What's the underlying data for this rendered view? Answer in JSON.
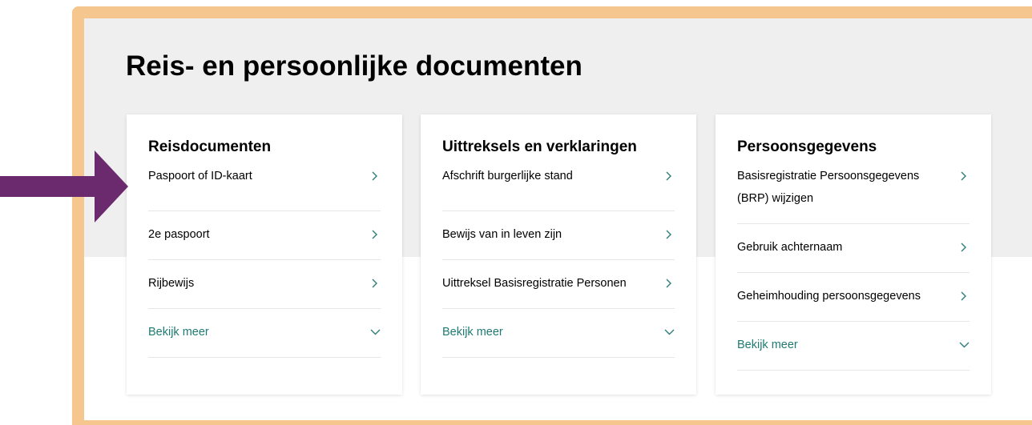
{
  "page": {
    "title": "Reis- en persoonlijke documenten"
  },
  "colors": {
    "frame": "#f5c78e",
    "band": "#efefef",
    "link": "#1f7a73",
    "arrow": "#6b2a6e"
  },
  "cards": [
    {
      "heading": "Reisdocumenten",
      "items": [
        "Paspoort of ID-kaart",
        "2e paspoort",
        "Rijbewijs"
      ],
      "more": "Bekijk meer"
    },
    {
      "heading": "Uittreksels en verklaringen",
      "items": [
        "Afschrift burgerlijke stand",
        "Bewijs van in leven zijn",
        "Uittreksel Basisregistratie Personen"
      ],
      "more": "Bekijk meer"
    },
    {
      "heading": "Persoonsgegevens",
      "items": [
        "Basisregistratie Persoonsgegevens (BRP) wijzigen",
        "Gebruik achternaam",
        "Geheimhouding persoonsgegevens"
      ],
      "more": "Bekijk meer"
    }
  ],
  "icons": {
    "item": "chevron-right-icon",
    "more": "chevron-down-icon",
    "pointer": "arrow-right-icon"
  }
}
